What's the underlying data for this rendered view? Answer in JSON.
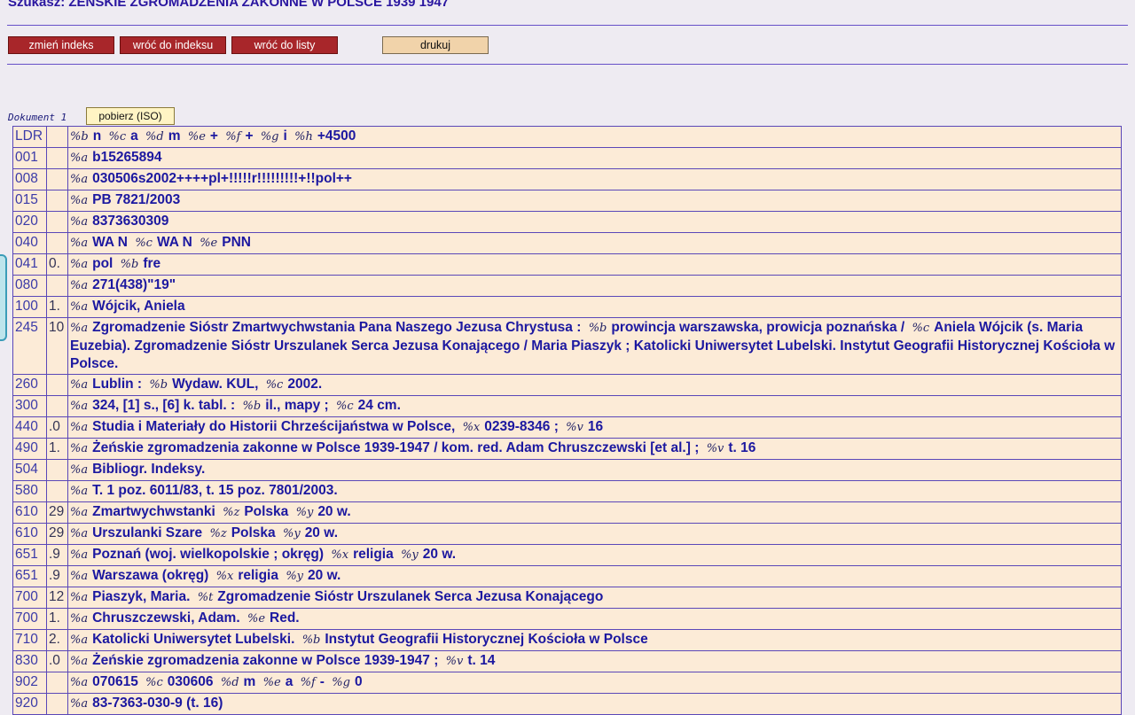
{
  "page_title": "Szukasz: ŻEŃSKIE ZGROMADZENIA ZAKONNE W POLSCE 1939 1947",
  "buttons": {
    "change_index": "zmień indeks",
    "back_to_index": "wróć do indeksu",
    "back_to_list": "wróć do listy",
    "print": "drukuj"
  },
  "document_label": "Dokument 1",
  "download_button": "pobierz (ISO)",
  "colors": {
    "background": "#eeebf2",
    "table_bg": "#fcebd7",
    "red_button": "#a8262a",
    "print_button": "#f1d3aa",
    "rule": "#6650c8"
  },
  "records": [
    {
      "tag": "LDR",
      "ind": "",
      "fields": [
        [
          "%b",
          "n"
        ],
        [
          "%c",
          "a"
        ],
        [
          "%d",
          "m"
        ],
        [
          "%e",
          "+"
        ],
        [
          "%f",
          "+"
        ],
        [
          "%g",
          "i"
        ],
        [
          "%h",
          "+4500"
        ]
      ]
    },
    {
      "tag": "001",
      "ind": "",
      "fields": [
        [
          "%a",
          "b15265894"
        ]
      ]
    },
    {
      "tag": "008",
      "ind": "",
      "fields": [
        [
          "%a",
          "030506s2002++++pl+!!!!!r!!!!!!!!!+!!pol++"
        ]
      ]
    },
    {
      "tag": "015",
      "ind": "",
      "fields": [
        [
          "%a",
          "PB 7821/2003"
        ]
      ]
    },
    {
      "tag": "020",
      "ind": "",
      "fields": [
        [
          "%a",
          "8373630309"
        ]
      ]
    },
    {
      "tag": "040",
      "ind": "",
      "fields": [
        [
          "%a",
          "WA N"
        ],
        [
          "%c",
          "WA N"
        ],
        [
          "%e",
          "PNN"
        ]
      ]
    },
    {
      "tag": "041",
      "ind": "0.",
      "fields": [
        [
          "%a",
          "pol"
        ],
        [
          "%b",
          "fre"
        ]
      ]
    },
    {
      "tag": "080",
      "ind": "",
      "fields": [
        [
          "%a",
          "271(438)\"19\""
        ]
      ]
    },
    {
      "tag": "100",
      "ind": "1.",
      "fields": [
        [
          "%a",
          "Wójcik, Aniela"
        ]
      ]
    },
    {
      "tag": "245",
      "ind": "10",
      "fields": [
        [
          "%a",
          "Zgromadzenie Sióstr Zmartwychwstania Pana Naszego Jezusa Chrystusa :"
        ],
        [
          "%b",
          "prowincja warszawska, prowicja poznańska /"
        ],
        [
          "%c",
          "Aniela Wójcik (s. Maria Euzebia). Zgromadzenie Sióstr Urszulanek Serca Jezusa Konającego / Maria Piaszyk ; Katolicki Uniwersytet Lubelski. Instytut Geografii Historycznej Kościoła w Polsce."
        ]
      ]
    },
    {
      "tag": "260",
      "ind": "",
      "fields": [
        [
          "%a",
          "Lublin :"
        ],
        [
          "%b",
          "Wydaw. KUL,"
        ],
        [
          "%c",
          "2002."
        ]
      ]
    },
    {
      "tag": "300",
      "ind": "",
      "fields": [
        [
          "%a",
          "324, [1] s., [6] k. tabl. :"
        ],
        [
          "%b",
          "il., mapy ;"
        ],
        [
          "%c",
          "24 cm."
        ]
      ]
    },
    {
      "tag": "440",
      "ind": ".0",
      "fields": [
        [
          "%a",
          "Studia i Materiały do Historii Chrześcijaństwa w Polsce,"
        ],
        [
          "%x",
          "0239-8346 ;"
        ],
        [
          "%v",
          "16"
        ]
      ]
    },
    {
      "tag": "490",
      "ind": "1.",
      "fields": [
        [
          "%a",
          "Żeńskie zgromadzenia zakonne w Polsce 1939-1947 / kom. red. Adam Chruszczewski [et al.] ;"
        ],
        [
          "%v",
          "t. 16"
        ]
      ]
    },
    {
      "tag": "504",
      "ind": "",
      "fields": [
        [
          "%a",
          "Bibliogr. Indeksy."
        ]
      ]
    },
    {
      "tag": "580",
      "ind": "",
      "fields": [
        [
          "%a",
          "T. 1 poz. 6011/83, t. 15 poz. 7801/2003."
        ]
      ]
    },
    {
      "tag": "610",
      "ind": "29",
      "fields": [
        [
          "%a",
          "Zmartwychwstanki"
        ],
        [
          "%z",
          "Polska"
        ],
        [
          "%y",
          "20 w."
        ]
      ]
    },
    {
      "tag": "610",
      "ind": "29",
      "fields": [
        [
          "%a",
          "Urszulanki Szare"
        ],
        [
          "%z",
          "Polska"
        ],
        [
          "%y",
          "20 w."
        ]
      ]
    },
    {
      "tag": "651",
      "ind": ".9",
      "fields": [
        [
          "%a",
          "Poznań (woj. wielkopolskie ; okręg)"
        ],
        [
          "%x",
          "religia"
        ],
        [
          "%y",
          "20 w."
        ]
      ]
    },
    {
      "tag": "651",
      "ind": ".9",
      "fields": [
        [
          "%a",
          "Warszawa (okręg)"
        ],
        [
          "%x",
          "religia"
        ],
        [
          "%y",
          "20 w."
        ]
      ]
    },
    {
      "tag": "700",
      "ind": "12",
      "fields": [
        [
          "%a",
          "Piaszyk, Maria."
        ],
        [
          "%t",
          "Zgromadzenie Sióstr Urszulanek Serca Jezusa Konającego"
        ]
      ]
    },
    {
      "tag": "700",
      "ind": "1.",
      "fields": [
        [
          "%a",
          "Chruszczewski, Adam."
        ],
        [
          "%e",
          "Red."
        ]
      ]
    },
    {
      "tag": "710",
      "ind": "2.",
      "fields": [
        [
          "%a",
          "Katolicki Uniwersytet Lubelski."
        ],
        [
          "%b",
          "Instytut Geografii Historycznej Kościoła w Polsce"
        ]
      ]
    },
    {
      "tag": "830",
      "ind": ".0",
      "fields": [
        [
          "%a",
          "Żeńskie zgromadzenia zakonne w Polsce 1939-1947 ;"
        ],
        [
          "%v",
          "t. 14"
        ]
      ]
    },
    {
      "tag": "902",
      "ind": "",
      "fields": [
        [
          "%a",
          "070615"
        ],
        [
          "%c",
          "030606"
        ],
        [
          "%d",
          "m"
        ],
        [
          "%e",
          "a"
        ],
        [
          "%f",
          "-"
        ],
        [
          "%g",
          "0"
        ]
      ]
    },
    {
      "tag": "920",
      "ind": "",
      "fields": [
        [
          "%a",
          "83-7363-030-9 (t. 16)"
        ]
      ]
    }
  ]
}
